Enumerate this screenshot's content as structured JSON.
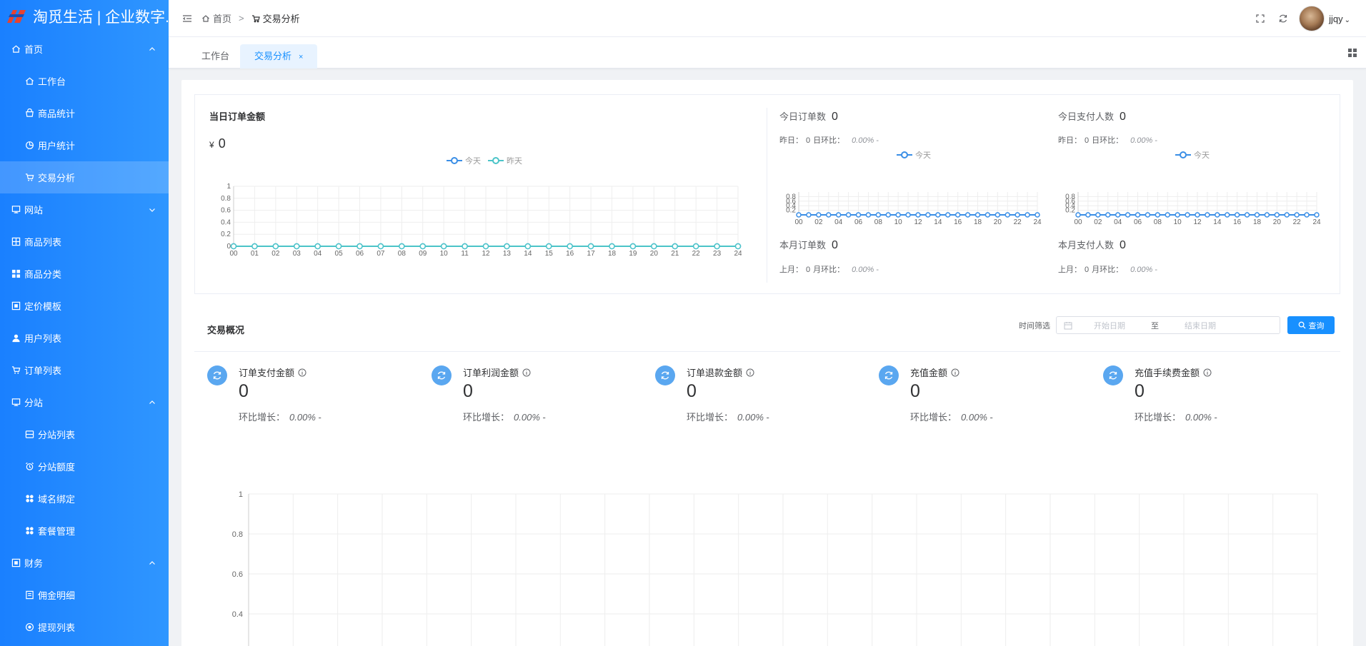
{
  "app": {
    "logo_text": "淘觅生活 | 企业数字..."
  },
  "sidebar": {
    "items": [
      {
        "label": "首页",
        "icon": "home-icon",
        "level": 0,
        "arrow": "up"
      },
      {
        "label": "工作台",
        "icon": "home-icon",
        "level": 1
      },
      {
        "label": "商品统计",
        "icon": "shop-icon",
        "level": 1
      },
      {
        "label": "用户统计",
        "icon": "pie-icon",
        "level": 1
      },
      {
        "label": "交易分析",
        "icon": "cart-icon",
        "level": 1,
        "active": true
      },
      {
        "label": "网站",
        "icon": "monitor-icon",
        "level": 0,
        "arrow": "down"
      },
      {
        "label": "商品列表",
        "icon": "grid-icon",
        "level": 0
      },
      {
        "label": "商品分类",
        "icon": "category-icon",
        "level": 0
      },
      {
        "label": "定价模板",
        "icon": "template-icon",
        "level": 0
      },
      {
        "label": "用户列表",
        "icon": "user-icon",
        "level": 0
      },
      {
        "label": "订单列表",
        "icon": "cart-icon",
        "level": 0
      },
      {
        "label": "分站",
        "icon": "monitor-icon",
        "level": 0,
        "arrow": "up"
      },
      {
        "label": "分站列表",
        "icon": "box-icon",
        "level": 1
      },
      {
        "label": "分站额度",
        "icon": "alarm-icon",
        "level": 1
      },
      {
        "label": "域名绑定",
        "icon": "flower-icon",
        "level": 1
      },
      {
        "label": "套餐管理",
        "icon": "flower-icon",
        "level": 1
      },
      {
        "label": "财务",
        "icon": "template-icon",
        "level": 0,
        "arrow": "up"
      },
      {
        "label": "佣金明细",
        "icon": "receipt-icon",
        "level": 1
      },
      {
        "label": "提现列表",
        "icon": "circle-icon",
        "level": 1
      }
    ]
  },
  "header": {
    "breadcrumb_home": "首页",
    "breadcrumb_sep": ">",
    "breadcrumb_current": "交易分析",
    "user_name": "jjqy"
  },
  "tabs": {
    "items": [
      {
        "label": "工作台"
      },
      {
        "label": "交易分析",
        "close": "×"
      }
    ]
  },
  "today_amount": {
    "title": "当日订单金额",
    "currency": "¥",
    "value": "0",
    "legend_today": "今天",
    "legend_yesterday": "昨天"
  },
  "stats": [
    {
      "label": "今日订单数",
      "value": "0",
      "sub_label": "昨日：",
      "sub_value": "0",
      "sub_ratio_label": "日环比：",
      "sub_ratio": "0.00%",
      "sub_dash": "-",
      "legend": "今天"
    },
    {
      "label": "今日支付人数",
      "value": "0",
      "sub_label": "昨日：",
      "sub_value": "0",
      "sub_ratio_label": "日环比：",
      "sub_ratio": "0.00%",
      "sub_dash": "-",
      "legend": "今天"
    },
    {
      "label": "本月订单数",
      "value": "0",
      "sub_label": "上月：",
      "sub_value": "0",
      "sub_ratio_label": "月环比：",
      "sub_ratio": "0.00%",
      "sub_dash": "-"
    },
    {
      "label": "本月支付人数",
      "value": "0",
      "sub_label": "上月：",
      "sub_value": "0",
      "sub_ratio_label": "月环比：",
      "sub_ratio": "0.00%",
      "sub_dash": "-"
    }
  ],
  "overview": {
    "title": "交易概况",
    "filter_label": "时间筛选",
    "start_placeholder": "开始日期",
    "range_sep": "至",
    "end_placeholder": "结束日期",
    "query_label": "查询",
    "metrics": [
      {
        "label": "订单支付金额",
        "value": "0",
        "sub_label": "环比增长：",
        "ratio": "0.00%",
        "dash": "-"
      },
      {
        "label": "订单利润金额",
        "value": "0",
        "sub_label": "环比增长：",
        "ratio": "0.00%",
        "dash": "-"
      },
      {
        "label": "订单退款金额",
        "value": "0",
        "sub_label": "环比增长：",
        "ratio": "0.00%",
        "dash": "-"
      },
      {
        "label": "充值金额",
        "value": "0",
        "sub_label": "环比增长：",
        "ratio": "0.00%",
        "dash": "-"
      },
      {
        "label": "充值手续费金额",
        "value": "0",
        "sub_label": "环比增长：",
        "ratio": "0.00%",
        "dash": "-"
      }
    ]
  },
  "colors": {
    "primary": "#1890ff",
    "today_line": "#3a8ee6",
    "yesterday_line": "#4bc4c8",
    "sidebar": "#1f87ff"
  },
  "chart_data": [
    {
      "type": "line",
      "title": "",
      "categories": [
        "00",
        "01",
        "02",
        "03",
        "04",
        "05",
        "06",
        "07",
        "08",
        "09",
        "10",
        "11",
        "12",
        "13",
        "14",
        "15",
        "16",
        "17",
        "18",
        "19",
        "20",
        "21",
        "22",
        "23",
        "24"
      ],
      "ylim": [
        0,
        1
      ],
      "yticks": [
        "0",
        "0.2",
        "0.4",
        "0.6",
        "0.8",
        "1"
      ],
      "series": [
        {
          "name": "今天",
          "values": [
            0,
            0,
            0,
            0,
            0,
            0,
            0,
            0,
            0,
            0,
            0,
            0,
            0,
            0,
            0,
            0,
            0,
            0,
            0,
            0,
            0,
            0,
            0,
            0,
            0
          ]
        },
        {
          "name": "昨天",
          "values": [
            0,
            0,
            0,
            0,
            0,
            0,
            0,
            0,
            0,
            0,
            0,
            0,
            0,
            0,
            0,
            0,
            0,
            0,
            0,
            0,
            0,
            0,
            0,
            0,
            0
          ]
        }
      ]
    },
    {
      "type": "line",
      "categories": [
        "00",
        "01",
        "02",
        "03",
        "04",
        "05",
        "06",
        "07",
        "08",
        "09",
        "10",
        "11",
        "12",
        "13",
        "14",
        "15",
        "16",
        "17",
        "18",
        "19",
        "20",
        "21",
        "22",
        "23",
        "24"
      ],
      "xtick_labels": [
        "00",
        "02",
        "04",
        "06",
        "08",
        "10",
        "12",
        "14",
        "16",
        "18",
        "20",
        "22",
        "24"
      ],
      "yticks": [
        "0.2",
        "0.4",
        "0.6",
        "0.8"
      ],
      "series": [
        {
          "name": "今天",
          "values": [
            0,
            0,
            0,
            0,
            0,
            0,
            0,
            0,
            0,
            0,
            0,
            0,
            0,
            0,
            0,
            0,
            0,
            0,
            0,
            0,
            0,
            0,
            0,
            0,
            0
          ]
        }
      ]
    },
    {
      "type": "line",
      "categories": [
        "00",
        "01",
        "02",
        "03",
        "04",
        "05",
        "06",
        "07",
        "08",
        "09",
        "10",
        "11",
        "12",
        "13",
        "14",
        "15",
        "16",
        "17",
        "18",
        "19",
        "20",
        "21",
        "22",
        "23",
        "24"
      ],
      "xtick_labels": [
        "00",
        "02",
        "04",
        "06",
        "08",
        "10",
        "12",
        "14",
        "16",
        "18",
        "20",
        "22",
        "24"
      ],
      "yticks": [
        "0.2",
        "0.4",
        "0.6",
        "0.8"
      ],
      "series": [
        {
          "name": "今天",
          "values": [
            0,
            0,
            0,
            0,
            0,
            0,
            0,
            0,
            0,
            0,
            0,
            0,
            0,
            0,
            0,
            0,
            0,
            0,
            0,
            0,
            0,
            0,
            0,
            0,
            0
          ]
        }
      ]
    },
    {
      "type": "line",
      "yticks": [
        "0.4",
        "0.6",
        "0.8",
        "1"
      ],
      "series": []
    }
  ]
}
